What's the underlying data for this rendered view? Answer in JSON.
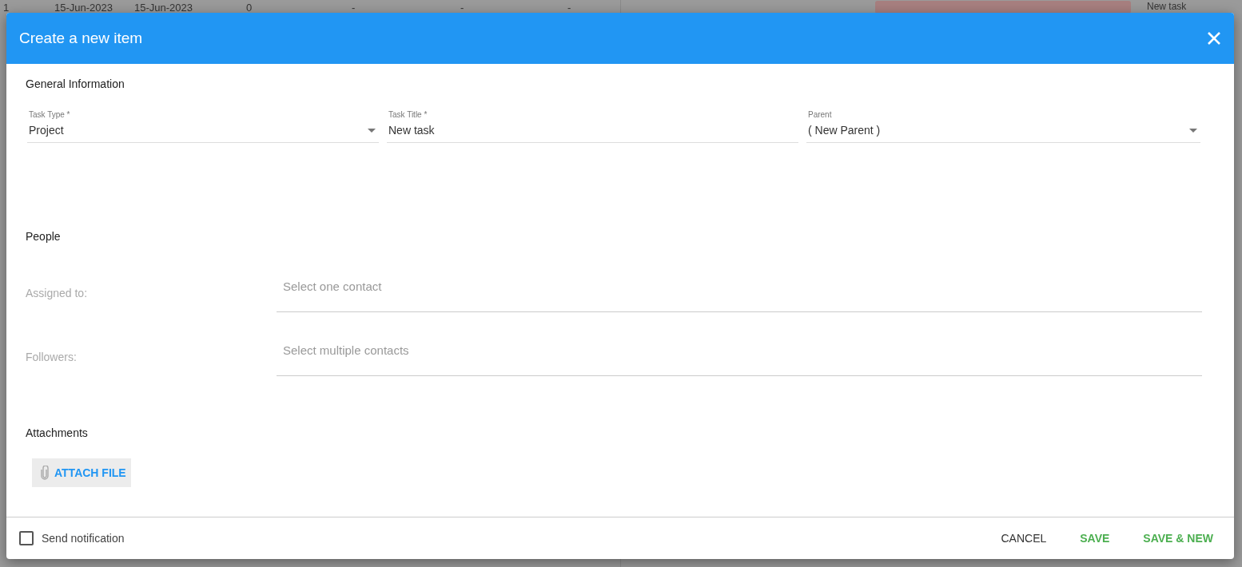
{
  "background_table": {
    "row": [
      "1",
      "15-Jun-2023",
      "15-Jun-2023",
      "0",
      "-",
      "-",
      "-"
    ],
    "gantt_label": "New task"
  },
  "dialog": {
    "title": "Create a new item",
    "general": {
      "heading": "General Information",
      "fields": [
        {
          "kind": "select",
          "label": "Task Type *",
          "value": "Project"
        },
        {
          "kind": "text",
          "label": "Task Title *",
          "value": "New task"
        },
        {
          "kind": "select",
          "label": "Parent",
          "value": "( New Parent )"
        }
      ]
    },
    "people": {
      "heading": "People",
      "rows": [
        {
          "label": "Assigned to:",
          "placeholder": "Select one contact"
        },
        {
          "label": "Followers:",
          "placeholder": "Select multiple contacts"
        }
      ]
    },
    "attachments": {
      "heading": "Attachments",
      "button": "ATTACH FILE"
    },
    "footer": {
      "notification": {
        "label": "Send notification",
        "checked": false
      },
      "buttons": [
        {
          "label": "CANCEL",
          "kind": "neutral"
        },
        {
          "label": "SAVE",
          "kind": "primary"
        },
        {
          "label": "SAVE & NEW",
          "kind": "primary"
        }
      ]
    }
  }
}
